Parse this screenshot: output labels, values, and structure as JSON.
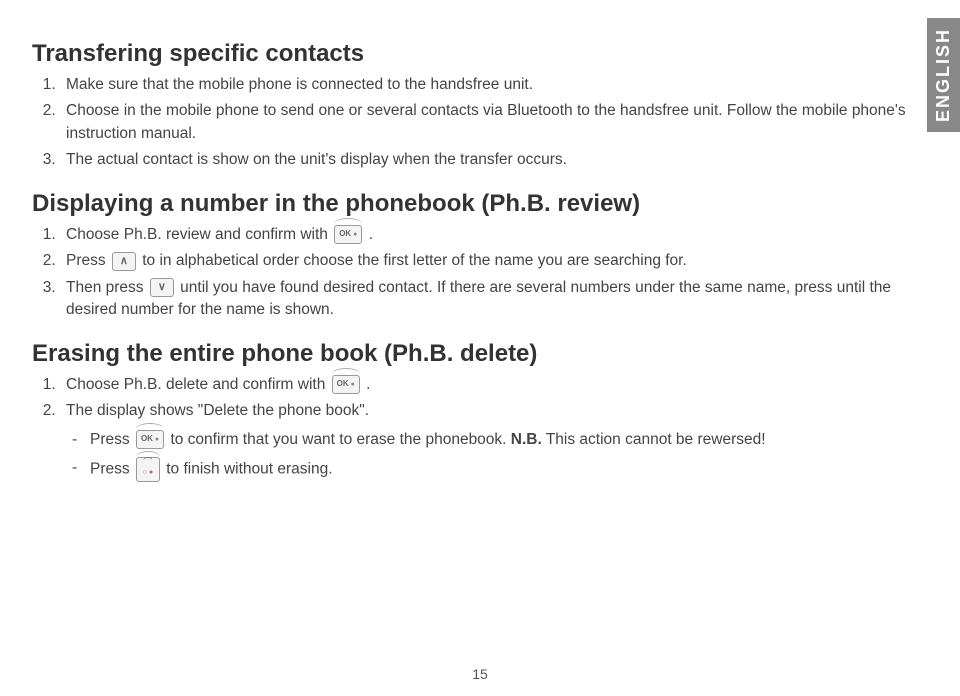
{
  "language_tab": "ENGLISH",
  "page_number": "15",
  "section1": {
    "heading": "Transfering specific contacts",
    "items": [
      "Make sure that the mobile phone is connected to the handsfree unit.",
      "Choose in the mobile phone to send one or several contacts via Bluetooth to the handsfree unit. Follow the mobile phone's instruction manual.",
      "The actual contact is show on the unit's display when the transfer occurs."
    ]
  },
  "section2": {
    "heading": "Displaying a number in the phonebook (Ph.B. review)",
    "item1_a": "Choose Ph.B. review and confirm with ",
    "item1_b": ".",
    "item2_a": "Press ",
    "item2_b": " to in alphabetical order choose the first letter of the name you are searching for.",
    "item3_a": "Then press ",
    "item3_b": " until you have found desired contact. If there are several numbers under the same name, press until the desired number for the name is shown."
  },
  "section3": {
    "heading": "Erasing the entire phone book (Ph.B. delete)",
    "item1_a": "Choose Ph.B. delete and confirm with ",
    "item1_b": ".",
    "item2": "The display shows \"Delete the phone book\".",
    "bullet1_a": "Press ",
    "bullet1_b": " to confirm that you want to erase the phonebook. ",
    "bullet1_nb": "N.B.",
    "bullet1_c": " This action cannot be rewersed!",
    "bullet2_a": "Press ",
    "bullet2_b": " to finish without erasing."
  }
}
